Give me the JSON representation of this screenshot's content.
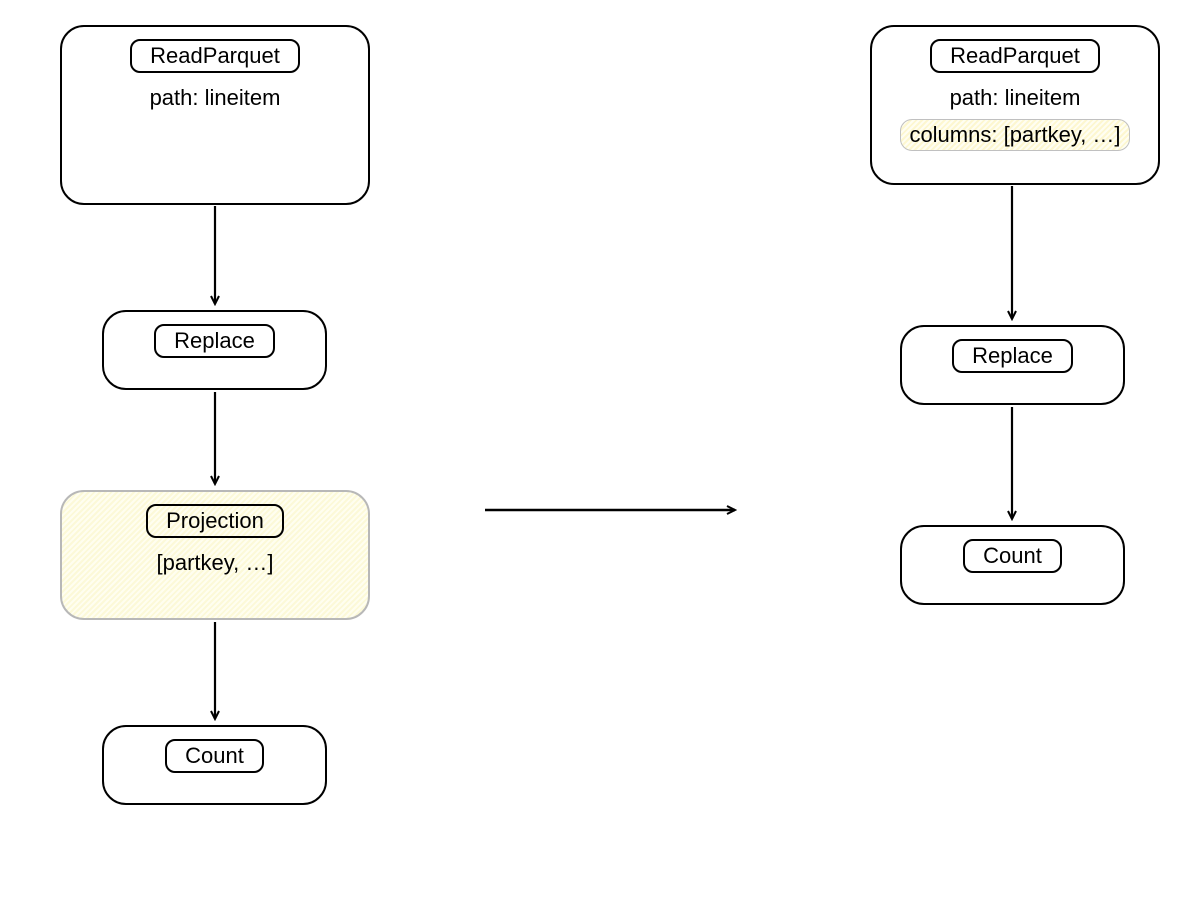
{
  "left": {
    "read_parquet": {
      "title": "ReadParquet",
      "path_label": "path: lineitem"
    },
    "replace": {
      "title": "Replace"
    },
    "projection": {
      "title": "Projection",
      "cols": "[partkey, …]"
    },
    "count": {
      "title": "Count"
    }
  },
  "right": {
    "read_parquet": {
      "title": "ReadParquet",
      "path_label": "path: lineitem",
      "cols_label": "columns: [partkey, …]"
    },
    "replace": {
      "title": "Replace"
    },
    "count": {
      "title": "Count"
    }
  }
}
